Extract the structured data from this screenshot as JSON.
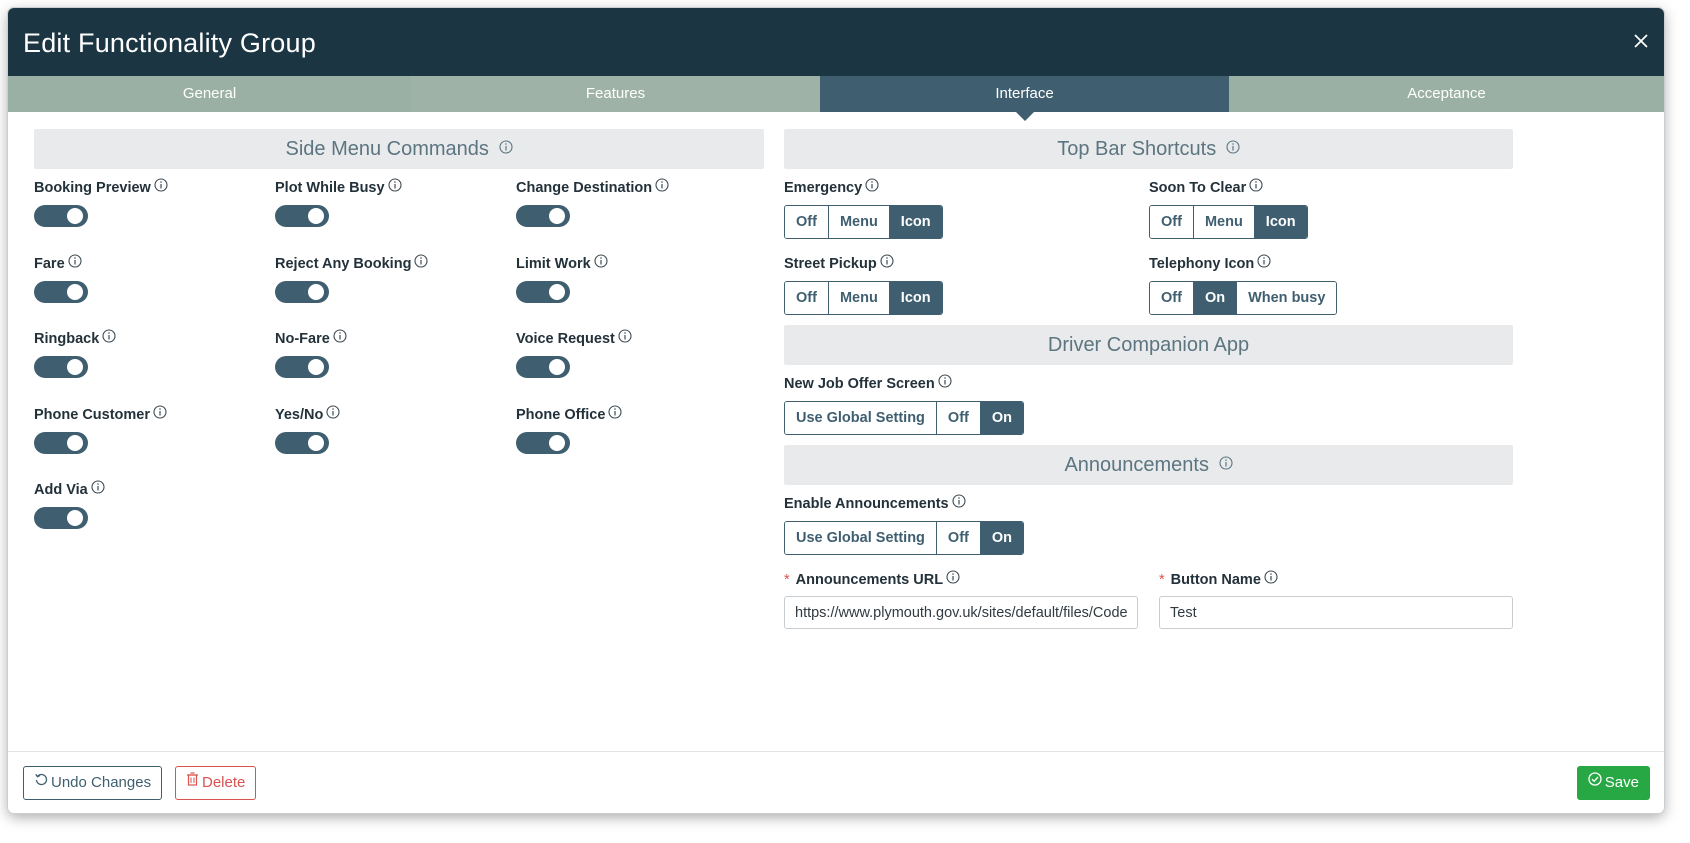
{
  "dialog": {
    "title": "Edit Functionality Group"
  },
  "tabs": [
    {
      "label": "General"
    },
    {
      "label": "Features"
    },
    {
      "label": "Interface"
    },
    {
      "label": "Acceptance"
    }
  ],
  "active_tab": "Interface",
  "side_menu": {
    "title": "Side Menu Commands",
    "toggles": [
      {
        "label": "Booking Preview",
        "on": true
      },
      {
        "label": "Plot While Busy",
        "on": true
      },
      {
        "label": "Change Destination",
        "on": true
      },
      {
        "label": "Fare",
        "on": true
      },
      {
        "label": "Reject Any Booking",
        "on": true
      },
      {
        "label": "Limit Work",
        "on": true
      },
      {
        "label": "Ringback",
        "on": true
      },
      {
        "label": "No-Fare",
        "on": true
      },
      {
        "label": "Voice Request",
        "on": true
      },
      {
        "label": "Phone Customer",
        "on": true
      },
      {
        "label": "Yes/No",
        "on": true
      },
      {
        "label": "Phone Office",
        "on": true
      },
      {
        "label": "Add Via",
        "on": true
      }
    ]
  },
  "top_bar": {
    "title": "Top Bar Shortcuts",
    "emergency": {
      "label": "Emergency",
      "options": [
        "Off",
        "Menu",
        "Icon"
      ],
      "selected": "Icon"
    },
    "soon_to_clear": {
      "label": "Soon To Clear",
      "options": [
        "Off",
        "Menu",
        "Icon"
      ],
      "selected": "Icon"
    },
    "street_pickup": {
      "label": "Street Pickup",
      "options": [
        "Off",
        "Menu",
        "Icon"
      ],
      "selected": "Icon"
    },
    "telephony_icon": {
      "label": "Telephony Icon",
      "options": [
        "Off",
        "On",
        "When busy"
      ],
      "selected": "On"
    }
  },
  "driver_app": {
    "title": "Driver Companion App",
    "new_job_offer": {
      "label": "New Job Offer Screen",
      "options": [
        "Use Global Setting",
        "Off",
        "On"
      ],
      "selected": "On"
    }
  },
  "announcements": {
    "title": "Announcements",
    "enable": {
      "label": "Enable Announcements",
      "options": [
        "Use Global Setting",
        "Off",
        "On"
      ],
      "selected": "On"
    },
    "url": {
      "label": "Announcements URL",
      "value": "https://www.plymouth.gov.uk/sites/default/files/Code"
    },
    "button_name": {
      "label": "Button Name",
      "value": "Test"
    },
    "required_mark": "*"
  },
  "footer": {
    "undo_label": "Undo Changes",
    "delete_label": "Delete",
    "save_label": "Save"
  },
  "colors": {
    "header": "#1b3542",
    "tab_inactive": "#9bb0a4",
    "tab_active": "#3f5f70",
    "toggle_on": "#3f5f70",
    "save": "#28a745",
    "delete": "#d9534f"
  }
}
